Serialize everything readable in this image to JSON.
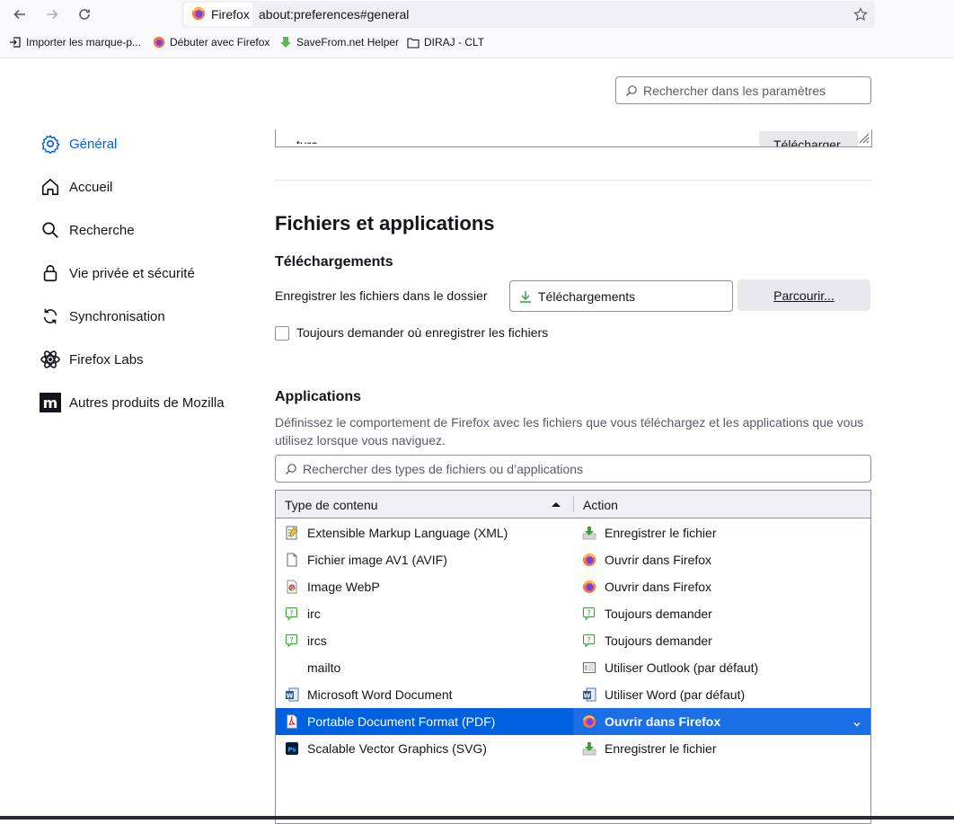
{
  "browser": {
    "tab_label": "Firefox",
    "url": "about:preferences#general",
    "bookmarks": [
      {
        "label": "Importer les marque-p...",
        "icon": "import-icon"
      },
      {
        "label": "Débuter avec Firefox",
        "icon": "firefox-icon"
      },
      {
        "label": "SaveFrom.net Helper",
        "icon": "green-download-icon"
      },
      {
        "label": "DIRAJ - CLT",
        "icon": "folder-icon"
      }
    ]
  },
  "search_prefs": {
    "placeholder": "Rechercher dans les paramètres"
  },
  "categories": [
    {
      "label": "Général",
      "icon": "gear-icon",
      "selected": true
    },
    {
      "label": "Accueil",
      "icon": "home-icon"
    },
    {
      "label": "Recherche",
      "icon": "search-icon"
    },
    {
      "label": "Vie privée et sécurité",
      "icon": "lock-icon"
    },
    {
      "label": "Synchronisation",
      "icon": "sync-icon"
    },
    {
      "label": "Firefox Labs",
      "icon": "atom-icon"
    },
    {
      "label": "Autres produits de Mozilla",
      "icon": "mozilla-m-icon"
    }
  ],
  "language": {
    "partial_item": "turc",
    "download_button": "Télécharger"
  },
  "files_apps": {
    "title": "Fichiers et applications",
    "downloads": {
      "title": "Téléchargements",
      "save_label": "Enregistrer les fichiers dans le dossier",
      "folder": "Téléchargements",
      "browse_button": "Parcourir...",
      "always_ask_label": "Toujours demander où enregistrer les fichiers",
      "always_ask_checked": false
    },
    "applications": {
      "title": "Applications",
      "description": "Définissez le comportement de Firefox avec les fichiers que vous téléchargez et les applications que vous utilisez lorsque vous naviguez.",
      "search_placeholder": "Rechercher des types de fichiers ou d’applications",
      "columns": {
        "type": "Type de contenu",
        "action": "Action"
      },
      "rows": [
        {
          "type": "Extensible Markup Language (XML)",
          "type_icon": "xml-file-icon",
          "action": "Enregistrer le fichier",
          "action_icon": "save-download-icon"
        },
        {
          "type": "Fichier image AV1 (AVIF)",
          "type_icon": "blank-file-icon",
          "action": "Ouvrir dans Firefox",
          "action_icon": "firefox-icon"
        },
        {
          "type": "Image WebP",
          "type_icon": "chrome-icon",
          "action": "Ouvrir dans Firefox",
          "action_icon": "firefox-icon"
        },
        {
          "type": "irc",
          "type_icon": "ask-icon",
          "action": "Toujours demander",
          "action_icon": "ask-icon"
        },
        {
          "type": "ircs",
          "type_icon": "ask-icon",
          "action": "Toujours demander",
          "action_icon": "ask-icon"
        },
        {
          "type": "mailto",
          "type_icon": "",
          "action": "Utiliser Outlook (par défaut)",
          "action_icon": "outlook-icon"
        },
        {
          "type": "Microsoft Word Document",
          "type_icon": "word-icon",
          "action": "Utiliser Word (par défaut)",
          "action_icon": "word-icon"
        },
        {
          "type": "Portable Document Format (PDF)",
          "type_icon": "pdf-icon",
          "action": "Ouvrir dans Firefox",
          "action_icon": "firefox-icon",
          "selected": true
        },
        {
          "type": "Scalable Vector Graphics (SVG)",
          "type_icon": "photoshop-icon",
          "action": "Enregistrer le fichier",
          "action_icon": "save-download-icon"
        }
      ]
    }
  }
}
